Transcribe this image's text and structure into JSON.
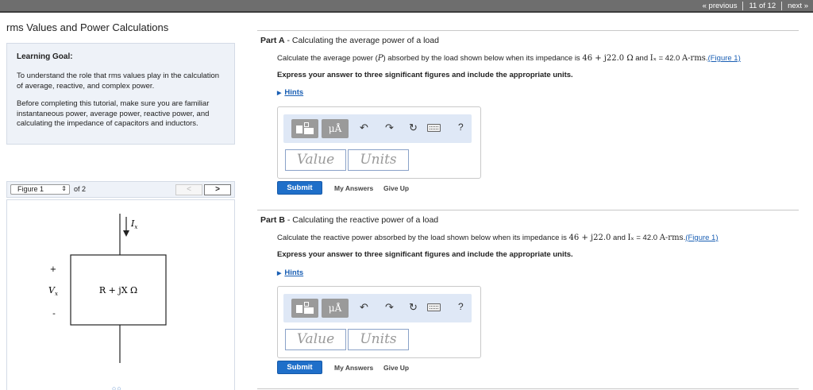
{
  "nav": {
    "previous": "« previous",
    "counter": "11 of 12",
    "next": "next »"
  },
  "title": "rms Values and Power Calculations",
  "goal": {
    "heading": "Learning Goal:",
    "p1": "To understand the role that rms values play in the calculation of average, reactive, and complex power.",
    "p2": "Before completing this tutorial, make sure you are familiar instantaneous power, average power, reactive power, and calculating the impedance of capacitors and inductors."
  },
  "figure": {
    "select": "Figure 1",
    "of": "of 2",
    "prev": "<",
    "next": ">",
    "current_label": "I",
    "current_sub": "x",
    "voltage_label": "V",
    "voltage_sub": "x",
    "plus": "+",
    "minus": "-",
    "impedance": "R + jX Ω",
    "dots": "○○"
  },
  "parts": [
    {
      "letter": "Part A",
      "title": "Calculating the average power of a load",
      "q_pre": "Calculate the average power (",
      "q_var": "P",
      "q_mid": ") absorbed by the load shown below when its impedance is ",
      "q_imp": "46 + j22.0 Ω",
      "q_and": " and ",
      "q_cur": "Iₓ",
      "q_eq": " = 42.0 ",
      "q_unit": "A-rms",
      "q_dot": ".",
      "fig_link": "(Figure 1)",
      "instructions": "Express your answer to three significant figures and include the appropriate units.",
      "hints": "Hints",
      "value_placeholder": "Value",
      "units_placeholder": "Units",
      "submit": "Submit",
      "my_answers": "My Answers",
      "give_up": "Give Up"
    },
    {
      "letter": "Part B",
      "title": "Calculating the reactive power of a load",
      "q_pre": "Calculate the reactive power absorbed by the load shown below when its impedance is ",
      "q_imp": "46 + j22.0",
      "q_and": " and ",
      "q_cur": "Iₓ",
      "q_eq": " = 42.0 ",
      "q_unit": "A-rms",
      "q_dot": ".",
      "fig_link": "(Figure 1)",
      "instructions": "Express your answer to three significant figures and include the appropriate units.",
      "hints": "Hints",
      "value_placeholder": "Value",
      "units_placeholder": "Units",
      "submit": "Submit",
      "my_answers": "My Answers",
      "give_up": "Give Up"
    }
  ],
  "toolbar": {
    "mu": "μÅ",
    "undo": "↶",
    "redo": "↷",
    "reset": "↻",
    "help": "?"
  }
}
